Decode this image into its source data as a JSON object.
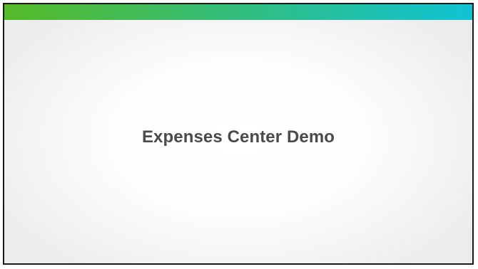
{
  "slide": {
    "title": "Expenses Center Demo"
  },
  "colors": {
    "gradient_start": "#55b927",
    "gradient_end": "#10c3d4",
    "title_text": "#4a4a4a",
    "border": "#1a1a1a"
  }
}
